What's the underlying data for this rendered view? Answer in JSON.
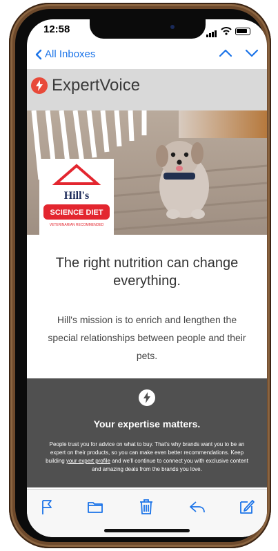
{
  "status": {
    "time": "12:58"
  },
  "nav": {
    "back_label": "All Inboxes"
  },
  "email": {
    "brand": "ExpertVoice",
    "headline": "The right nutrition can change everything.",
    "mission": "Hill's mission is to enrich and lengthen the special relationships between people and their pets.",
    "hills_logo": {
      "top": "Hill's",
      "badge": "SCIENCE DIET",
      "sub": "VETERINARIAN RECOMMENDED"
    },
    "dark": {
      "title": "Your expertise matters.",
      "body_1": "People trust you for advice on what to buy. That's why brands want you to be an expert on their products, so you can make even better recommendations. Keep building ",
      "link": "your expert profile",
      "body_2": " and we'll continue to connect you with exclusive content and amazing deals from the brands you love."
    }
  },
  "colors": {
    "accent": "#1a73e8",
    "expertvoice_red": "#e84a3a",
    "dark_band": "#505050",
    "header_gray": "#d9d9d9",
    "hills_red": "#e3262f"
  },
  "toolbar": {
    "items": [
      "flag-icon",
      "folder-icon",
      "trash-icon",
      "reply-icon",
      "compose-icon"
    ]
  }
}
